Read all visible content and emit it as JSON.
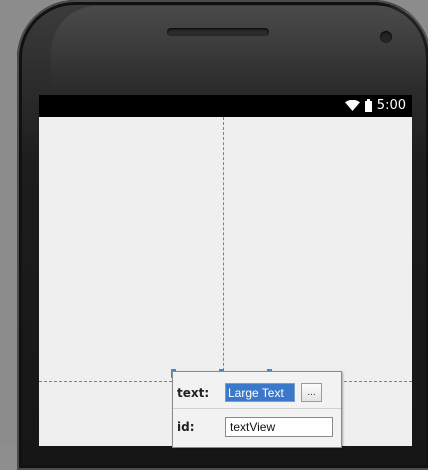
{
  "status_bar": {
    "time": "5:00",
    "icons": [
      "wifi-icon",
      "battery-icon"
    ]
  },
  "property_popup": {
    "text_label": "text:",
    "text_value": "Large Text",
    "browse_label": "...",
    "id_label": "id:",
    "id_value": "textView"
  },
  "colors": {
    "guide": "#3cb43c",
    "selection": "#3b8fe0",
    "status_bar": "#000000",
    "screen": "#efefef"
  }
}
